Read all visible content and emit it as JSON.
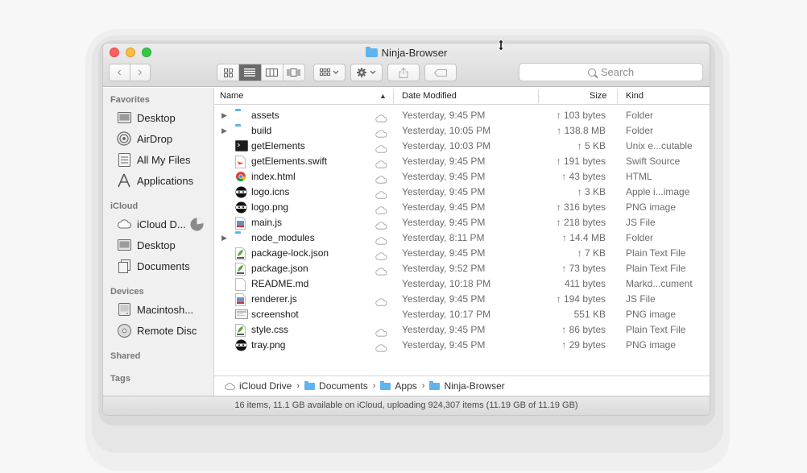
{
  "window": {
    "title": "Ninja-Browser"
  },
  "toolbar": {
    "back_label": "‹",
    "forward_label": "›",
    "search_placeholder": "Search"
  },
  "sidebar": {
    "favorites_header": "Favorites",
    "favorites": [
      {
        "label": "Desktop",
        "icon": "desktop-icon"
      },
      {
        "label": "AirDrop",
        "icon": "airdrop-icon"
      },
      {
        "label": "All My Files",
        "icon": "all-files-icon"
      },
      {
        "label": "Applications",
        "icon": "applications-icon"
      }
    ],
    "icloud_header": "iCloud",
    "icloud": [
      {
        "label": "iCloud D...",
        "icon": "cloud-icon"
      },
      {
        "label": "Desktop",
        "icon": "desktop-icon"
      },
      {
        "label": "Documents",
        "icon": "documents-icon"
      }
    ],
    "devices_header": "Devices",
    "devices": [
      {
        "label": "Macintosh...",
        "icon": "hard-drive-icon"
      },
      {
        "label": "Remote Disc",
        "icon": "disc-icon"
      }
    ],
    "shared_header": "Shared",
    "tags_header": "Tags"
  },
  "columns": {
    "name": "Name",
    "date": "Date Modified",
    "size": "Size",
    "kind": "Kind"
  },
  "files": [
    {
      "name": "assets",
      "date": "Yesterday, 9:45 PM",
      "size": "↑ 103 bytes",
      "kind": "Folder",
      "icon": "folder-icon",
      "folder": true,
      "cloud": true
    },
    {
      "name": "build",
      "date": "Yesterday, 10:05 PM",
      "size": "↑ 138.8 MB",
      "kind": "Folder",
      "icon": "folder-icon",
      "folder": true,
      "cloud": true
    },
    {
      "name": "getElements",
      "date": "Yesterday, 10:03 PM",
      "size": "↑ 5 KB",
      "kind": "Unix e...cutable",
      "icon": "terminal-icon",
      "folder": false,
      "cloud": true
    },
    {
      "name": "getElements.swift",
      "date": "Yesterday, 9:45 PM",
      "size": "↑ 191 bytes",
      "kind": "Swift Source",
      "icon": "swift-file-icon",
      "folder": false,
      "cloud": true
    },
    {
      "name": "index.html",
      "date": "Yesterday, 9:45 PM",
      "size": "↑ 43 bytes",
      "kind": "HTML",
      "icon": "chrome-file-icon",
      "folder": false,
      "cloud": true
    },
    {
      "name": "logo.icns",
      "date": "Yesterday, 9:45 PM",
      "size": "↑ 3 KB",
      "kind": "Apple i...image",
      "icon": "ninja-logo-icon",
      "folder": false,
      "cloud": true
    },
    {
      "name": "logo.png",
      "date": "Yesterday, 9:45 PM",
      "size": "↑ 316 bytes",
      "kind": "PNG image",
      "icon": "ninja-logo-icon",
      "folder": false,
      "cloud": true
    },
    {
      "name": "main.js",
      "date": "Yesterday, 9:45 PM",
      "size": "↑ 218 bytes",
      "kind": "JS File",
      "icon": "js-file-icon",
      "folder": false,
      "cloud": true
    },
    {
      "name": "node_modules",
      "date": "Yesterday, 8:11 PM",
      "size": "↑ 14.4 MB",
      "kind": "Folder",
      "icon": "folder-icon",
      "folder": true,
      "cloud": true
    },
    {
      "name": "package-lock.json",
      "date": "Yesterday, 9:45 PM",
      "size": "↑ 7 KB",
      "kind": "Plain Text File",
      "icon": "json-file-icon",
      "folder": false,
      "cloud": true
    },
    {
      "name": "package.json",
      "date": "Yesterday, 9:52 PM",
      "size": "↑ 73 bytes",
      "kind": "Plain Text File",
      "icon": "json-file-icon",
      "folder": false,
      "cloud": true
    },
    {
      "name": "README.md",
      "date": "Yesterday, 10:18 PM",
      "size": "411 bytes",
      "kind": "Markd...cument",
      "icon": "document-icon",
      "folder": false,
      "cloud": false
    },
    {
      "name": "renderer.js",
      "date": "Yesterday, 9:45 PM",
      "size": "↑ 194 bytes",
      "kind": "JS File",
      "icon": "js-file-icon",
      "folder": false,
      "cloud": true
    },
    {
      "name": "screenshot",
      "date": "Yesterday, 10:17 PM",
      "size": "551 KB",
      "kind": "PNG image",
      "icon": "image-file-icon",
      "folder": false,
      "cloud": false
    },
    {
      "name": "style.css",
      "date": "Yesterday, 9:45 PM",
      "size": "↑ 86 bytes",
      "kind": "Plain Text File",
      "icon": "css-file-icon",
      "folder": false,
      "cloud": true
    },
    {
      "name": "tray.png",
      "date": "Yesterday, 9:45 PM",
      "size": "↑ 29 bytes",
      "kind": "PNG image",
      "icon": "ninja-logo-icon",
      "folder": false,
      "cloud": true
    }
  ],
  "pathbar": {
    "items": [
      "iCloud Drive",
      "Documents",
      "Apps",
      "Ninja-Browser"
    ],
    "separator": "›"
  },
  "status": {
    "text": "16 items, 11.1 GB available on iCloud, uploading 924,307 items (11.19 GB of 11.19 GB)"
  },
  "colors": {
    "folder": "#5fb4ef",
    "close": "#fc605c",
    "minimize": "#fdbc40",
    "maximize": "#34c84a"
  }
}
